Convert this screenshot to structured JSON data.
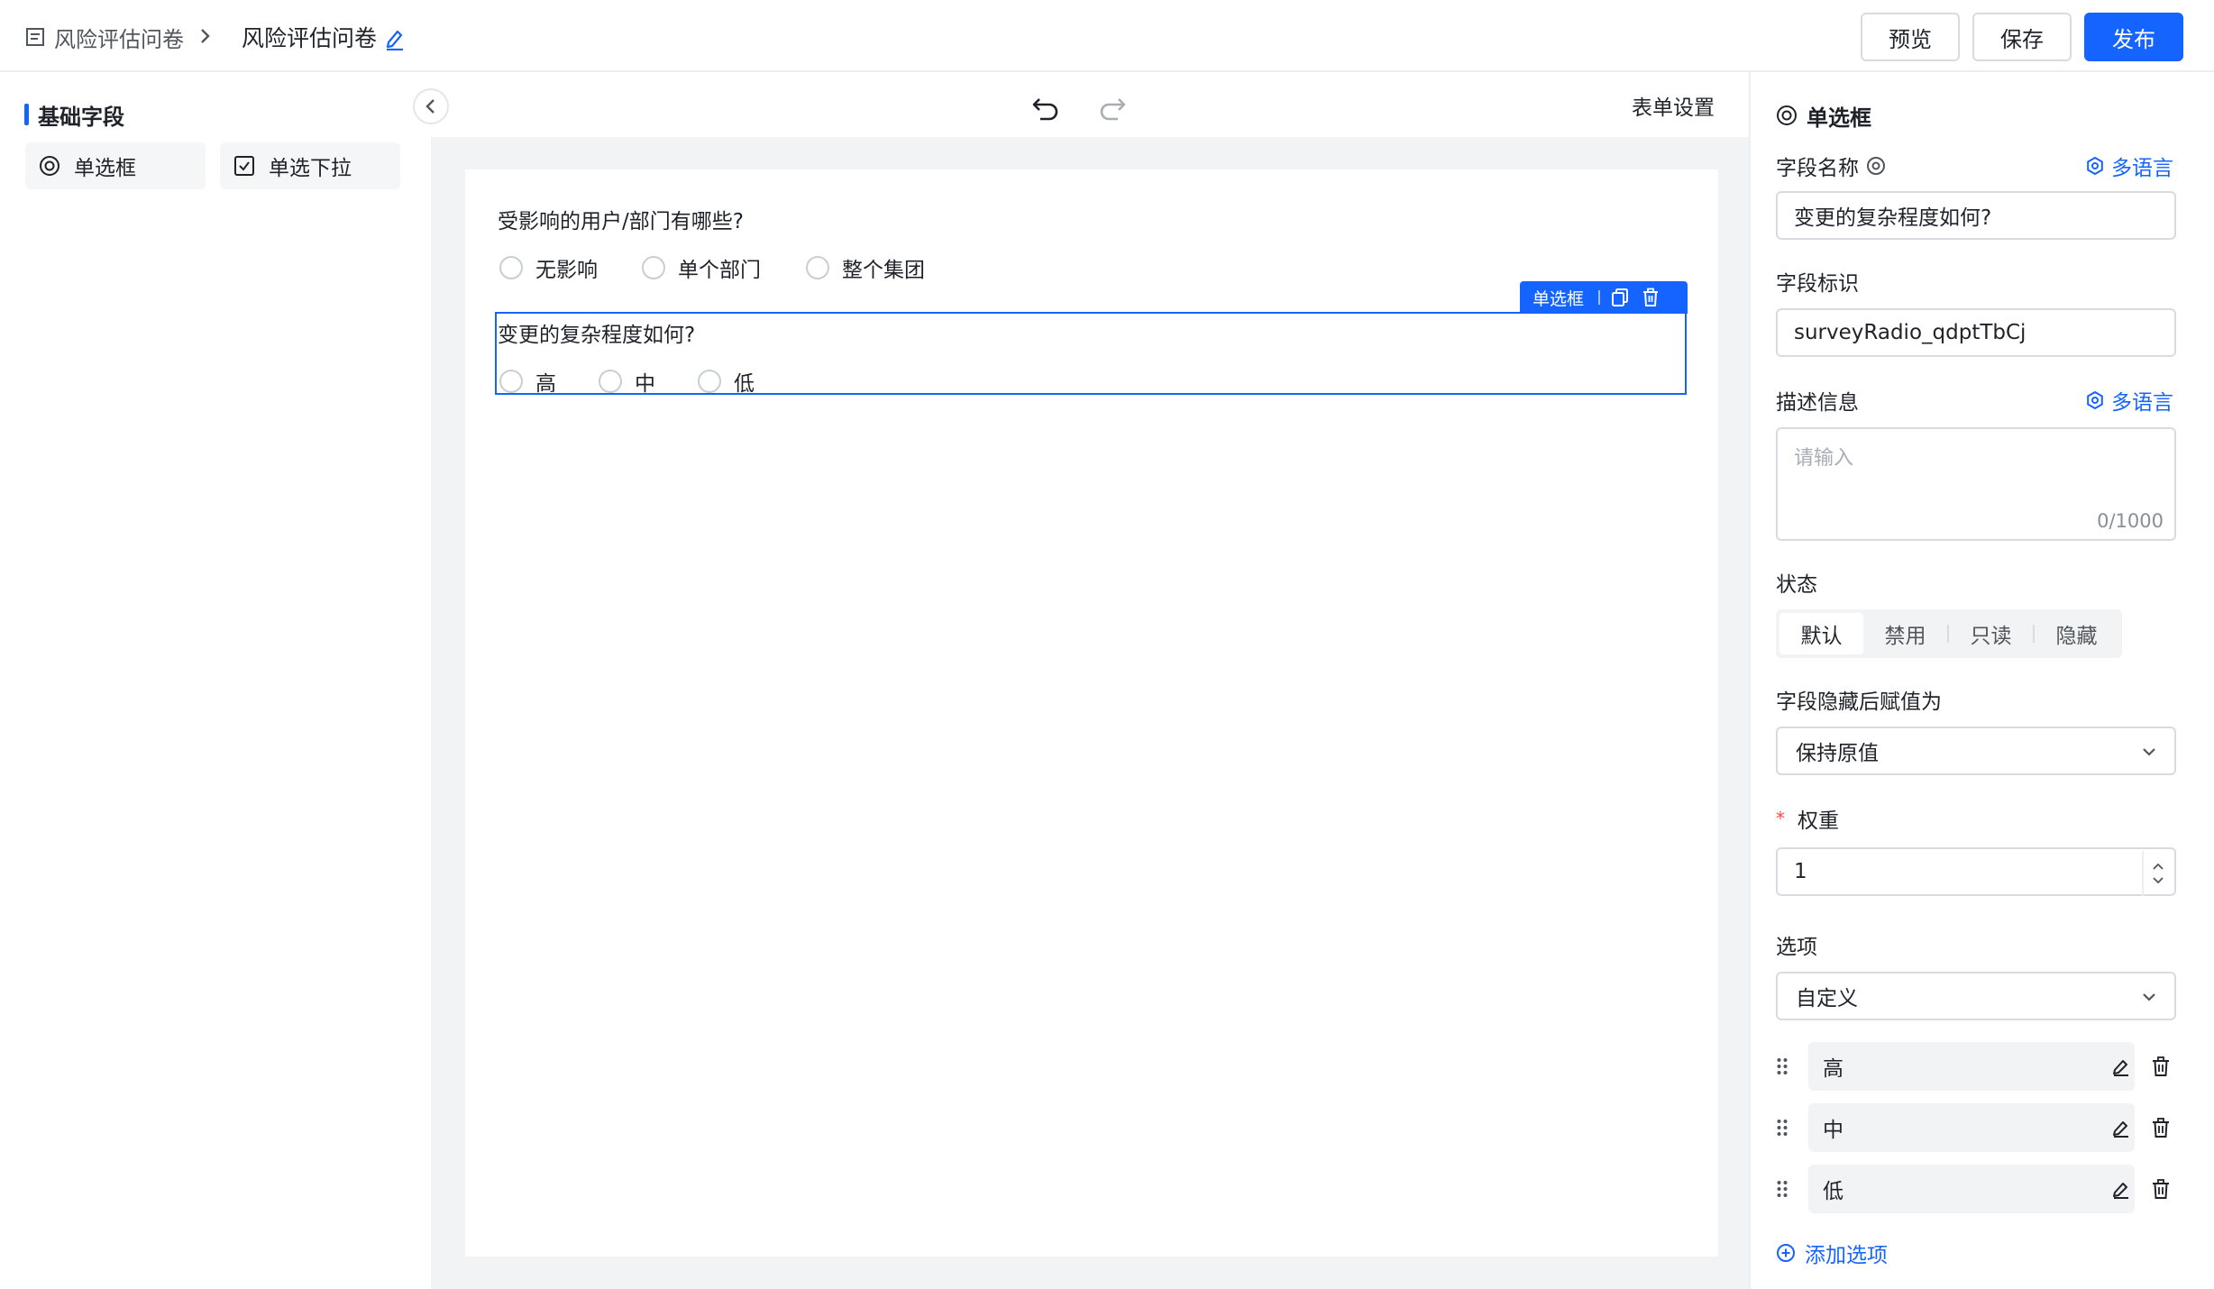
{
  "header": {
    "breadcrumb_root": "风险评估问卷",
    "breadcrumb_current": "风险评估问卷",
    "preview_label": "预览",
    "save_label": "保存",
    "publish_label": "发布"
  },
  "left_panel": {
    "section_title": "基础字段",
    "fields": [
      {
        "label": "单选框",
        "icon": "radio-icon"
      },
      {
        "label": "单选下拉",
        "icon": "checkbox-icon"
      }
    ]
  },
  "canvas": {
    "form_settings_label": "表单设置",
    "questions": [
      {
        "title": "受影响的用户/部门有哪些?",
        "options": [
          "无影响",
          "单个部门",
          "整个集团"
        ]
      },
      {
        "title": "变更的复杂程度如何?",
        "options": [
          "高",
          "中",
          "低"
        ]
      }
    ],
    "selected_tag_label": "单选框"
  },
  "right_panel": {
    "title": "单选框",
    "field_name_label": "字段名称",
    "multilang_label": "多语言",
    "field_name_value": "变更的复杂程度如何?",
    "field_id_label": "字段标识",
    "field_id_value": "surveyRadio_qdptTbCj",
    "description_label": "描述信息",
    "description_placeholder": "请输入",
    "description_counter": "0/1000",
    "status_label": "状态",
    "status_options": [
      "默认",
      "禁用",
      "只读",
      "隐藏"
    ],
    "status_selected": "默认",
    "hidden_value_label": "字段隐藏后赋值为",
    "hidden_value_selected": "保持原值",
    "weight_required_mark": "*",
    "weight_label": "权重",
    "weight_value": "1",
    "options_label": "选项",
    "options_source_selected": "自定义",
    "option_items": [
      "高",
      "中",
      "低"
    ],
    "add_option_label": "添加选项"
  },
  "colors": {
    "primary": "#1664ff",
    "canvas_bg": "#f2f3f5",
    "border": "#d8dbe0",
    "required": "#f54a45"
  }
}
